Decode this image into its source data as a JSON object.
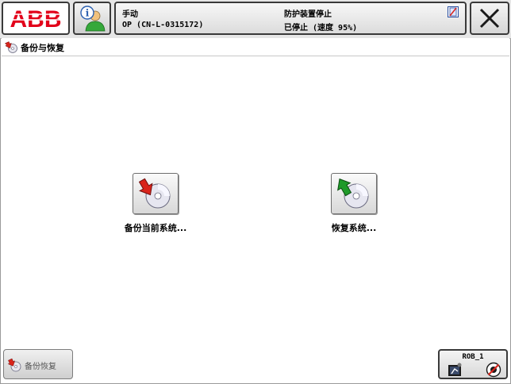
{
  "header": {
    "logo_text": "ABB",
    "status": {
      "mode": "手动",
      "operator": "OP (CN-L-0315172)",
      "guard_state": "防护装置停止",
      "run_state": "已停止 (速度 95%)"
    }
  },
  "page": {
    "title": "备份与恢复"
  },
  "actions": {
    "backup_label": "备份当前系统...",
    "restore_label": "恢复系统..."
  },
  "taskbar": {
    "app_label": "备份恢复"
  },
  "robot": {
    "label": "ROB_1"
  },
  "colors": {
    "abb_red": "#e2001a",
    "arrow_red": "#d9241b",
    "arrow_green": "#1f9a2a"
  }
}
